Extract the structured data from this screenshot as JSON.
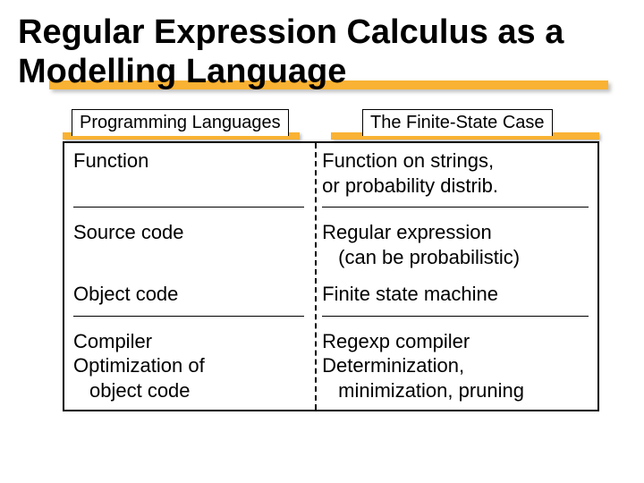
{
  "title": "Regular Expression Calculus as a Modelling Language",
  "headers": {
    "left": "Programming Languages",
    "right": "The Finite-State Case"
  },
  "rows": {
    "r1": {
      "left": "Function",
      "right_l1": "Function on strings,",
      "right_l2": "or probability distrib."
    },
    "r2": {
      "left": "Source code",
      "right_l1": "Regular expression",
      "right_l2": "(can be probabilistic)"
    },
    "r3": {
      "left": "Object code",
      "right": "Finite state machine"
    },
    "r4": {
      "left_l1": "Compiler",
      "left_l2": "Optimization of",
      "left_l3": "object code",
      "right_l1": "Regexp compiler",
      "right_l2": "Determinization,",
      "right_l3": "minimization, pruning"
    }
  }
}
